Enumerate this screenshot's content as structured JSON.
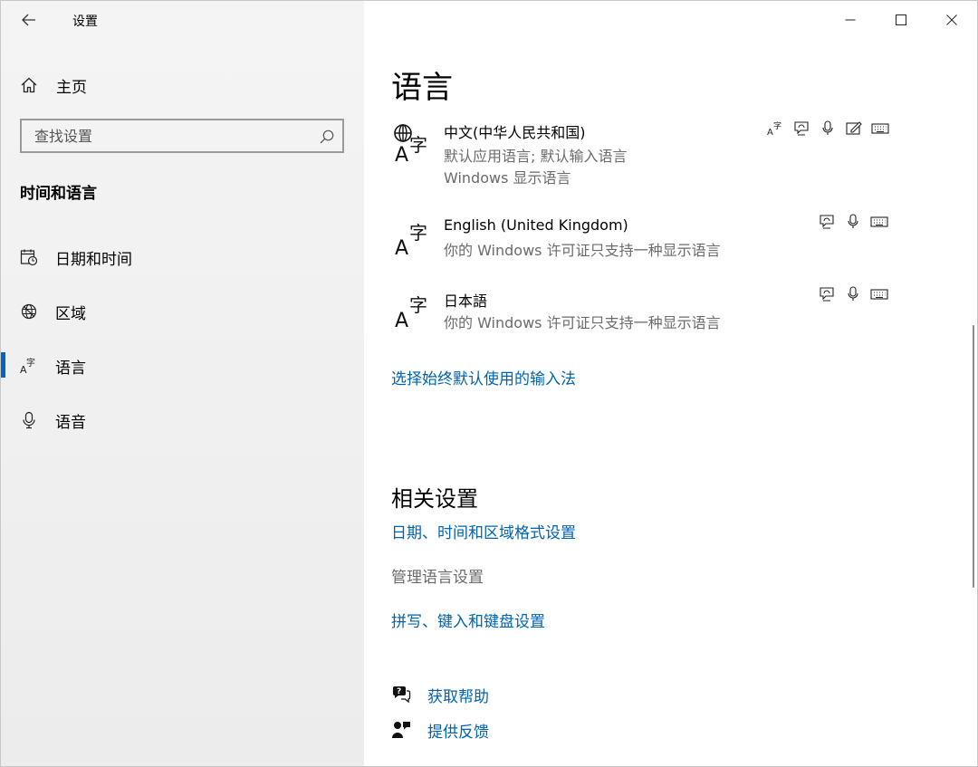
{
  "window": {
    "title": "设置"
  },
  "sidebar": {
    "home": "主页",
    "search_placeholder": "查找设置",
    "section": "时间和语言",
    "items": [
      {
        "label": "日期和时间",
        "icon": "calendar-clock-icon"
      },
      {
        "label": "区域",
        "icon": "globe-region-icon"
      },
      {
        "label": "语言",
        "icon": "language-icon",
        "active": true
      },
      {
        "label": "语音",
        "icon": "microphone-icon"
      }
    ]
  },
  "main": {
    "title": "语言",
    "languages": [
      {
        "name": "中文(中华人民共和国)",
        "desc1": "默认应用语言; 默认输入语言",
        "desc2": "Windows 显示语言",
        "features": [
          "display-language-icon",
          "text-to-speech-icon",
          "speech-recognition-icon",
          "handwriting-icon",
          "keyboard-icon"
        ]
      },
      {
        "name": "English (United Kingdom)",
        "desc1": "你的 Windows 许可证只支持一种显示语言",
        "features": [
          "text-to-speech-icon",
          "speech-recognition-icon",
          "keyboard-icon"
        ]
      },
      {
        "name": "日本語",
        "desc1": "你的 Windows 许可证只支持一种显示语言",
        "features": [
          "text-to-speech-icon",
          "speech-recognition-icon",
          "keyboard-icon"
        ]
      }
    ],
    "choose_input_link": "选择始终默认使用的输入法",
    "related_title": "相关设置",
    "related_links": {
      "date_region": "日期、时间和区域格式设置",
      "manage_lang": "管理语言设置",
      "spelling": "拼写、键入和键盘设置"
    },
    "help": {
      "get_help": "获取帮助",
      "feedback": "提供反馈"
    }
  },
  "colors": {
    "accent": "#0067c0",
    "link": "#0063b1",
    "sidebar_bg": "#f2f2f2"
  }
}
